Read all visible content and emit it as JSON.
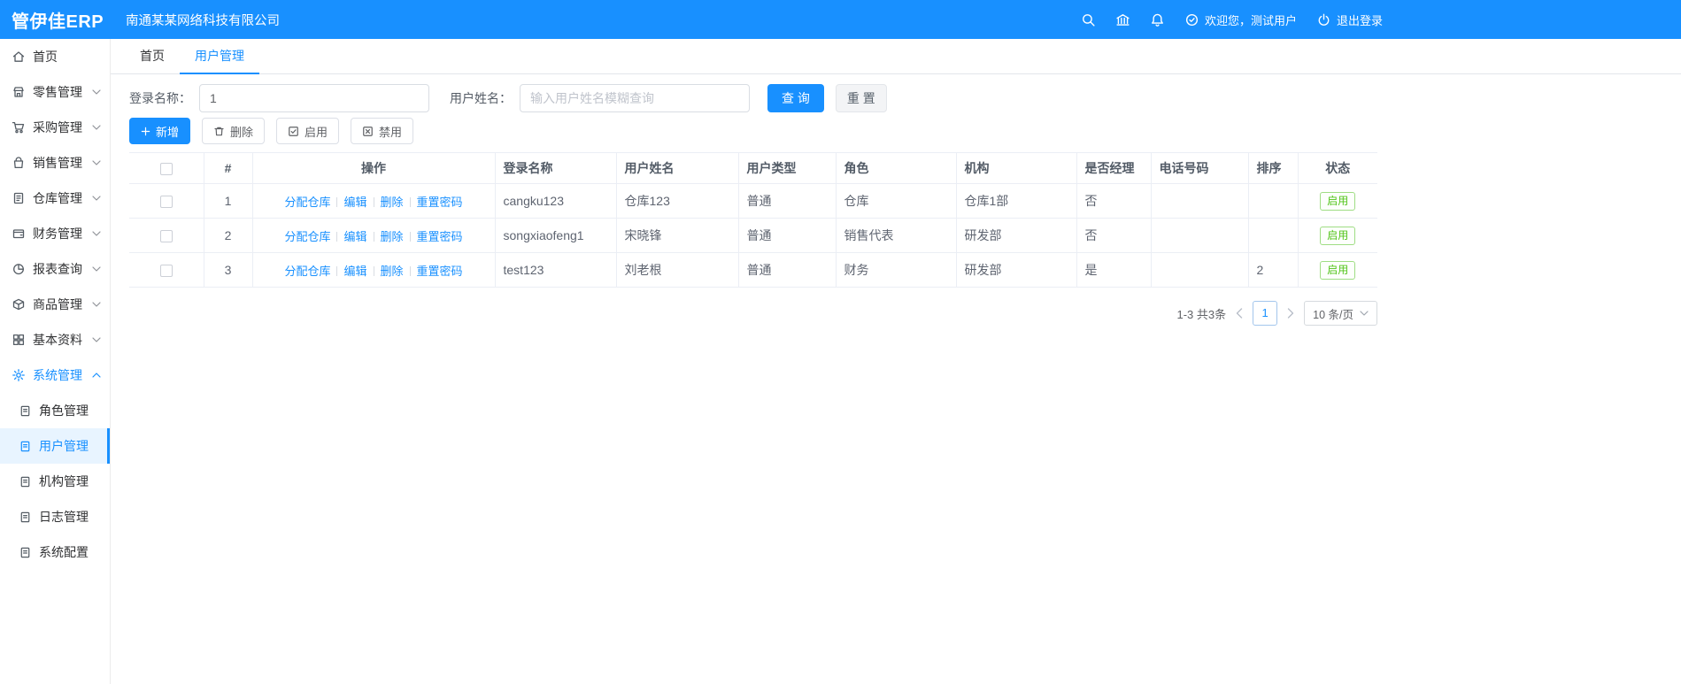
{
  "topbar": {
    "logo": "管伊佳ERP",
    "company": "南通某某网络科技有限公司",
    "welcome": "欢迎您，测试用户",
    "logout": "退出登录"
  },
  "icons": {
    "topbar": [
      "search-icon",
      "home-nav-icon",
      "bell-icon",
      "user-circle-icon",
      "logout-icon"
    ],
    "toolbar": [
      "plus-icon",
      "trash-icon",
      "check-square-icon",
      "x-square-icon"
    ],
    "submenu": "doc-icon"
  },
  "sidebar": {
    "items": [
      {
        "label": "首页",
        "icon": "home-icon"
      },
      {
        "label": "零售管理",
        "icon": "store-icon"
      },
      {
        "label": "采购管理",
        "icon": "cart-icon"
      },
      {
        "label": "销售管理",
        "icon": "bag-icon"
      },
      {
        "label": "仓库管理",
        "icon": "notebook-icon"
      },
      {
        "label": "财务管理",
        "icon": "wallet-icon"
      },
      {
        "label": "报表查询",
        "icon": "pie-chart-icon"
      },
      {
        "label": "商品管理",
        "icon": "box-icon"
      },
      {
        "label": "基本资料",
        "icon": "grid-icon"
      },
      {
        "label": "系统管理",
        "icon": "gear-icon"
      }
    ],
    "system_children": [
      {
        "label": "角色管理"
      },
      {
        "label": "用户管理"
      },
      {
        "label": "机构管理"
      },
      {
        "label": "日志管理"
      },
      {
        "label": "系统配置"
      }
    ]
  },
  "tabs": [
    {
      "label": "首页"
    },
    {
      "label": "用户管理"
    }
  ],
  "filters": {
    "login_name_label": "登录名称：",
    "login_name_value": "1",
    "user_name_label": "用户姓名：",
    "user_name_placeholder": "输入用户姓名模糊查询",
    "search_button": "查 询",
    "reset_button": "重 置"
  },
  "toolbar": {
    "add": "新增",
    "delete": "删除",
    "enable": "启用",
    "disable": "禁用"
  },
  "table": {
    "headers": {
      "index": "#",
      "actions": "操作",
      "login_name": "登录名称",
      "user_name": "用户姓名",
      "user_type": "用户类型",
      "role": "角色",
      "org": "机构",
      "is_manager": "是否经理",
      "phone": "电话号码",
      "sort": "排序",
      "status": "状态"
    },
    "action_links": [
      "分配仓库",
      "编辑",
      "删除",
      "重置密码"
    ],
    "rows": [
      {
        "index": "1",
        "login_name": "cangku123",
        "user_name": "仓库123",
        "user_type": "普通",
        "role": "仓库",
        "org": "仓库1部",
        "is_manager": "否",
        "phone": "",
        "sort": "",
        "status": "启用"
      },
      {
        "index": "2",
        "login_name": "songxiaofeng1",
        "user_name": "宋晓锋",
        "user_type": "普通",
        "role": "销售代表",
        "org": "研发部",
        "is_manager": "否",
        "phone": "",
        "sort": "",
        "status": "启用"
      },
      {
        "index": "3",
        "login_name": "test123",
        "user_name": "刘老根",
        "user_type": "普通",
        "role": "财务",
        "org": "研发部",
        "is_manager": "是",
        "phone": "",
        "sort": "2",
        "status": "启用"
      }
    ]
  },
  "pagination": {
    "total_text": "1-3 共3条",
    "current_page": "1",
    "page_size": "10 条/页"
  },
  "colors": {
    "primary": "#1890ff",
    "success": "#52c41a",
    "active_menu_bg": "#e8f4ff"
  }
}
